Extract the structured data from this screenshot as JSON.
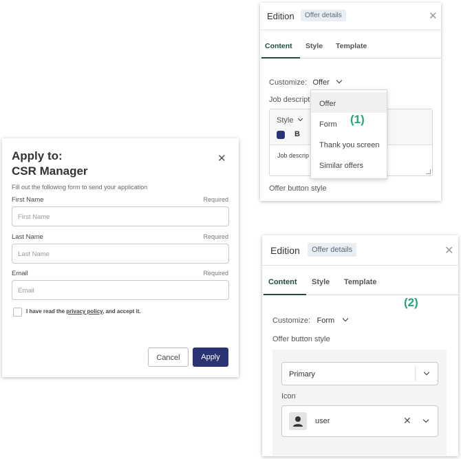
{
  "panel1": {
    "title": "Edition",
    "badge": "Offer details",
    "tabs": [
      "Content",
      "Style",
      "Template"
    ],
    "customize_label": "Customize:",
    "customize_value": "Offer",
    "job_description_label": "Job descript",
    "editor_style_label": "Style",
    "editor_bold": "B",
    "editor_color": "#2b3473",
    "editor_text": "Job descrip",
    "offer_button_style_label": "Offer button style",
    "dropdown_options": [
      "Offer",
      "Form",
      "Thank you screen",
      "Similar offers"
    ],
    "annotation": "(1)"
  },
  "apply_dialog": {
    "title_line1": "Apply to:",
    "title_line2": "CSR Manager",
    "subtitle": "Fill out the following form to send your application",
    "fields": [
      {
        "label": "First Name",
        "required": "Required",
        "placeholder": "First Name"
      },
      {
        "label": "Last Name",
        "required": "Required",
        "placeholder": "Last Name"
      },
      {
        "label": "Email",
        "required": "Required",
        "placeholder": "Email"
      }
    ],
    "consent_before": "I have read the ",
    "consent_link": "privacy policy",
    "consent_after": ", and accept it.",
    "cancel_label": "Cancel",
    "apply_label": "Apply",
    "apply_color": "#2b3473"
  },
  "panel2": {
    "title": "Edition",
    "badge": "Offer details",
    "tabs": [
      "Content",
      "Style",
      "Template"
    ],
    "annotation": "(2)",
    "customize_label": "Customize:",
    "customize_value": "Form",
    "offer_button_style_label": "Offer button style",
    "button_style_value": "Primary",
    "icon_label": "Icon",
    "icon_value": "user",
    "accent_color": "#1f4d3c",
    "annotation_color": "#22a57e"
  }
}
